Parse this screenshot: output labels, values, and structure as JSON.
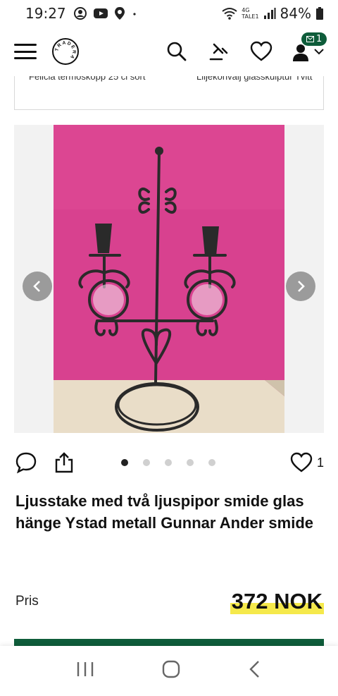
{
  "status_bar": {
    "time": "19:27",
    "network_top": "4G",
    "network_bottom": "TALE1",
    "battery": "84%",
    "icons": [
      "profile-circle-icon",
      "youtube-icon",
      "location-icon",
      "dot-icon",
      "wifi-icon",
      "signal-icon",
      "battery-icon"
    ]
  },
  "header": {
    "logo_text": "TRADERA",
    "message_count": "1",
    "icons": [
      "menu-icon",
      "search-icon",
      "auction-icon",
      "heart-icon",
      "user-icon"
    ]
  },
  "recent": {
    "left_text": "Felicia termoskopp 25 cl sort",
    "right_text": "Liljekonvalj glasskulptur Tvitt"
  },
  "gallery": {
    "current_image": 1,
    "image_count": 5
  },
  "actions": {
    "like_count": "1"
  },
  "listing": {
    "title": "Ljusstake med två ljuspipor smide glas hänge Ystad metall Gunnar Ander smide",
    "price_label": "Pris",
    "price": "372 NOK"
  },
  "colors": {
    "brand_green": "#0e5c3a",
    "price_highlight": "#f5e94b",
    "photo_background": "#d8418f"
  }
}
